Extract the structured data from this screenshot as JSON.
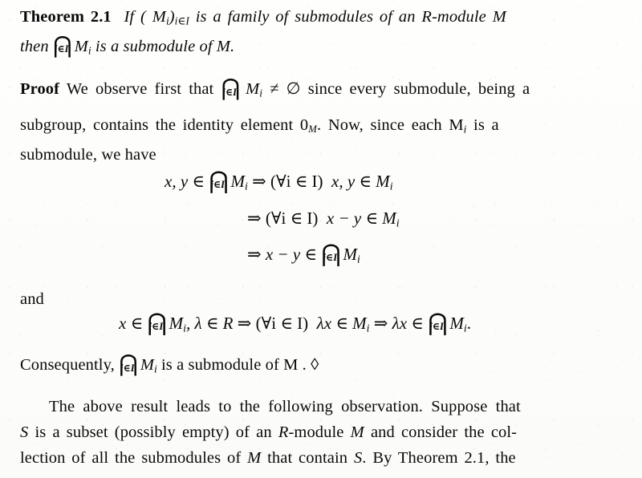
{
  "document": {
    "type": "mathematics-textbook-page",
    "theorem": {
      "label": "Theorem",
      "number": "2.1",
      "line1_a": "If ( M",
      "line1_sub": "i",
      "line1_b": ")",
      "line1_limit": "i∈I",
      "line1_c": "is a family of submodules of an R-module M",
      "line2_a": "then",
      "line2_cap": "⋂",
      "line2_limit": "i∈I",
      "line2_b": "M",
      "line2_sub": "i",
      "line2_c": "is a submodule of M."
    },
    "proof": {
      "label": "Proof",
      "line1_a": "We observe first that",
      "line1_cap": "⋂",
      "line1_limit": "i∈I",
      "line1_b": "M",
      "line1_sub": "i",
      "line1_c": "≠ ∅ since every submodule, being a",
      "line2_a": "subgroup, contains the identity element 0",
      "line2_sub": "M",
      "line2_b": ". Now, since each M",
      "line2_sub2": "i",
      "line2_c": "is a",
      "line3": "submodule, we have"
    },
    "display1": {
      "line1": {
        "lhs": "x, y ∈",
        "cap": "⋂",
        "limit": "i∈I",
        "m": "M",
        "sub": "i",
        "arrow": "⇒",
        "quant": "(∀i ∈ I)",
        "rhs": "x, y ∈ M",
        "rhs_sub": "i"
      },
      "line2": {
        "arrow": "⇒",
        "quant": "(∀i ∈ I)",
        "rhs": "x − y ∈ M",
        "rhs_sub": "i"
      },
      "line3": {
        "arrow": "⇒",
        "lhs": "x − y ∈",
        "cap": "⋂",
        "limit": "i∈I",
        "m": "M",
        "sub": "i"
      }
    },
    "connective": "and",
    "display2": {
      "lhs": "x ∈",
      "cap1": "⋂",
      "limit1": "i∈I",
      "m1": "M",
      "sub1": "i",
      "mid": ", λ ∈ R",
      "arrow1": "⇒",
      "quant": "(∀i ∈ I)",
      "mid2": "λx ∈ M",
      "sub2": "i",
      "arrow2": "⇒",
      "rhs": "λx ∈",
      "cap2": "⋂",
      "limit2": "i∈I",
      "m2": "M",
      "sub3": "i",
      "period": "."
    },
    "consequently": {
      "a": "Consequently,",
      "cap": "⋂",
      "limit": "i∈I",
      "m": "M",
      "sub": "i",
      "b": "is a submodule of M . ◊"
    },
    "tail": {
      "line1": "The above result leads to the following observation.  Suppose that",
      "line2_a": "S",
      "line2_b": "is a subset (possibly empty) of an",
      "line2_c": "R",
      "line2_d": "-module",
      "line2_e": "M",
      "line2_f": "and consider the col-",
      "line3_a": "lection of all the submodules of",
      "line3_b": "M",
      "line3_c": "that contain",
      "line3_d": "S",
      "line3_e": ". By Theorem 2.1, the"
    }
  },
  "colors": {
    "ink": "#0a0a0a",
    "paper": "#fdfdfb"
  }
}
